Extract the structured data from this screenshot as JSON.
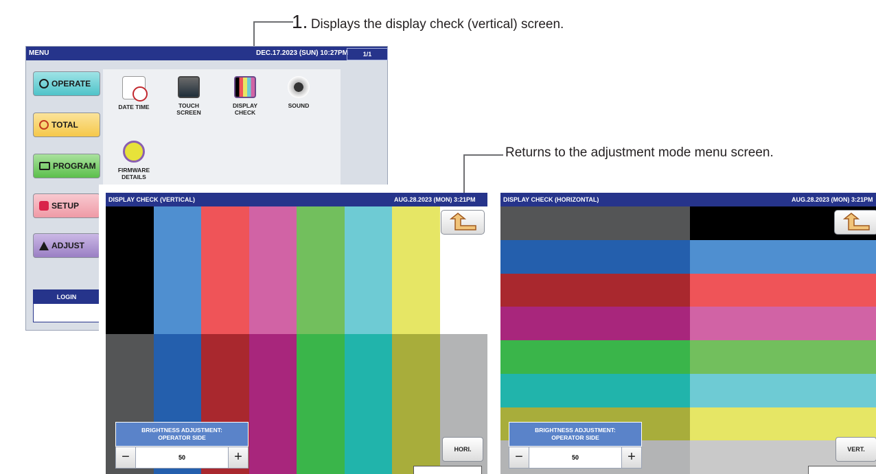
{
  "callouts": {
    "step1_number": "1.",
    "step1_text": "Displays the display check (vertical) screen.",
    "return_text": "Returns to the adjustment mode menu screen."
  },
  "menu": {
    "title": "MENU",
    "date": "DEC.17.2023 (SUN)  10:27PM",
    "page": "1/1",
    "buttons": [
      {
        "label": "OPERATE",
        "color": "#4fc3c9"
      },
      {
        "label": "TOTAL",
        "color": "#f5c84a"
      },
      {
        "label": "PROGRAM",
        "color": "#5cbf4c"
      },
      {
        "label": "SETUP",
        "color": "#ef9aa6"
      },
      {
        "label": "ADJUST",
        "color": "#9a7fc4"
      }
    ],
    "apps": [
      {
        "line1": "DATE TIME",
        "line2": ""
      },
      {
        "line1": "TOUCH",
        "line2": "SCREEN"
      },
      {
        "line1": "DISPLAY",
        "line2": "CHECK"
      },
      {
        "line1": "SOUND",
        "line2": ""
      },
      {
        "line1": "FIRMWARE",
        "line2": "DETAILS"
      }
    ],
    "login_label": "LOGIN"
  },
  "vertical": {
    "title": "DISPLAY CHECK (VERTICAL)",
    "date": "AUG.28.2023 (MON)   3:21PM",
    "top_colors": [
      "#000000",
      "#4f8fd0",
      "#ef5458",
      "#d163a5",
      "#72bf5d",
      "#6ecbd4",
      "#e6e665",
      "#ffffff"
    ],
    "bottom_colors": [
      "#545556",
      "#245fad",
      "#a9282e",
      "#a8267c",
      "#3ab54a",
      "#21b4ab",
      "#a8ad3b",
      "#b3b4b5"
    ],
    "brightness_label_1": "BRIGHTNESS ADJUSTMENT:",
    "brightness_label_2": "OPERATOR SIDE",
    "brightness_value": "50",
    "minus": "−",
    "plus": "+",
    "toggle_label": "HORI."
  },
  "horizontal": {
    "title": "DISPLAY CHECK (HORIZONTAL)",
    "date": "AUG.28.2023 (MON)   3:21PM",
    "left_colors": [
      "#545556",
      "#245fad",
      "#a9282e",
      "#a8267c",
      "#3ab54a",
      "#21b4ab",
      "#a8ad3b",
      "#b3b4b5"
    ],
    "right_colors": [
      "#000000",
      "#4f8fd0",
      "#ef5458",
      "#d163a5",
      "#72bf5d",
      "#6ecbd4",
      "#e6e665",
      "#c9c9c9"
    ],
    "brightness_label_1": "BRIGHTNESS ADJUSTMENT:",
    "brightness_label_2": "OPERATOR SIDE",
    "brightness_value": "50",
    "minus": "−",
    "plus": "+",
    "toggle_label": "VERT."
  }
}
